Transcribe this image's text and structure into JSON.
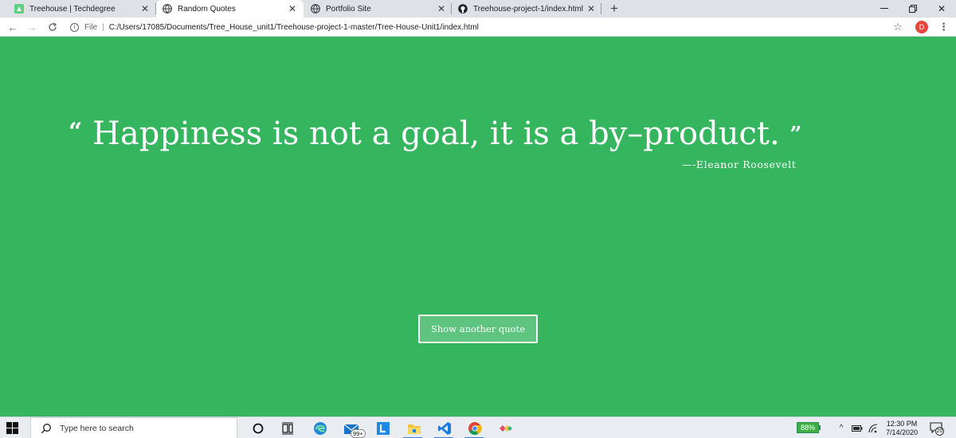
{
  "browser": {
    "tabs": [
      {
        "title": "Treehouse | Techdegree",
        "favicon": "treehouse-icon"
      },
      {
        "title": "Random Quotes",
        "favicon": "globe-icon"
      },
      {
        "title": "Portfolio Site",
        "favicon": "globe-icon"
      },
      {
        "title": "Treehouse-project-1/index.html",
        "favicon": "github-icon"
      }
    ],
    "active_tab": 1,
    "address": {
      "scheme_label": "File",
      "url": "C:/Users/17085/Documents/Tree_House_unit1/Treehouse-project-1-master/Tree-House-Unit1/index.html"
    },
    "profile_initial": "D",
    "profile_color": "#e8453c"
  },
  "page": {
    "background_color": "#36b55f",
    "quote": {
      "open_mark": "“",
      "text": "Happiness is not a goal, it is a by–product.",
      "close_mark": "”"
    },
    "source": "—-Eleanor Roosevelt",
    "button_label": "Show another quote"
  },
  "taskbar": {
    "search_placeholder": "Type here to search",
    "mail_badge": "99+",
    "battery": "88%",
    "time": "12:30 PM",
    "date": "7/14/2020",
    "notification_count": "20"
  }
}
